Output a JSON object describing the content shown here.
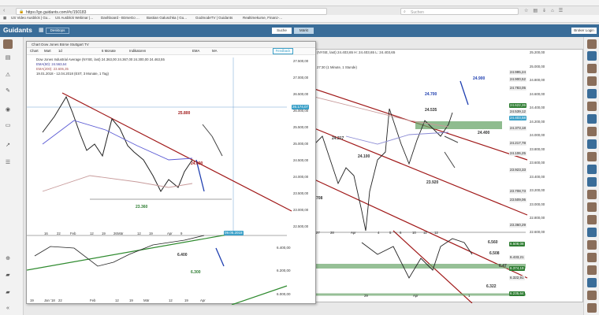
{
  "browser": {
    "url": "https://go.guidants.com/#c/150183",
    "search_placeholder": "Suchen"
  },
  "bookmarks": [
    "US Video Ausblick | Gu...",
    "US Ausblick Webinar |...",
    "Dashboard - BörseGo ...",
    "Bastian Galuschka | Gu...",
    "GodmodeTV | Guidants",
    "Realtimekurse, Finanz-..."
  ],
  "app": {
    "logo": "Guidants",
    "desktop": "Desktops",
    "search_btn": "Suche",
    "markt_btn": "Märkt",
    "broker_btn": "Broker Login",
    "colors": {
      "appbar": "#3a6d99",
      "accent": "#3aa0c8"
    }
  },
  "left_chart": {
    "title": "Chart Dow Jones Börse Stuttgart TV",
    "toolbar": [
      "Chart",
      "Mart",
      "1d",
      "6 Monate",
      "Indikatoren",
      "EMA",
      "MA",
      "Feedback"
    ],
    "legend": [
      "Dow Jones Industrial Average (NYSE, last)  24.363,00  24.367,00  24.300,00  24.463,55",
      "EMA(50): 24.563,64",
      "EMA(200): 23.606,35",
      "19.01.2018 - 12.04.2018 (EST, 3 Monate, 1 Tag)"
    ],
    "price_labels": [
      "27.500,00",
      "27.000,00",
      "26.500,00",
      "26.000,00",
      "25.500,00",
      "25.000,00",
      "24.500,00",
      "24.000,00",
      "23.500,00",
      "23.000,00",
      "22.500,00"
    ],
    "hl": "26.174,07",
    "date_tag": "09.05.2018",
    "annotations": {
      "a": "25.800",
      "b": "24.600",
      "c": "23.360"
    },
    "lower": {
      "labels": [
        "6.400,00",
        "6.200,00",
        "6.000,00"
      ],
      "a": "6.400",
      "b": "6.300"
    },
    "x_labels": [
      "16",
      "22",
      "Feb",
      "12",
      "19",
      "26",
      "Mär",
      "12",
      "19",
      "Apr",
      "9"
    ],
    "x_labels_lower": [
      "19",
      "Jan '18",
      "22",
      "Feb",
      "12",
      "19",
      "Mär",
      "12",
      "19",
      "Apr"
    ]
  },
  "right_chart": {
    "legend": [
      "(NYSE, last)  24.403,65  H: 24.403,65  L: 24.403,65",
      "27:30  (1 Minute, 1 Stunde)"
    ],
    "price_labels": [
      "25.200,00",
      "25.000,00",
      "24.800,00",
      "24.600,00",
      "24.400,00",
      "24.200,00",
      "24.000,00",
      "23.800,00",
      "23.600,00",
      "23.400,00",
      "23.200,00",
      "23.000,00",
      "22.800,00",
      "22.600,00"
    ],
    "tags": [
      "24.995,24",
      "24.900,52",
      "24.783,05",
      "24.622,26",
      "24.539,12",
      "24.403,58",
      "24.373,18",
      "24.217,78",
      "24.106,25",
      "23.923,33",
      "23.708,73",
      "23.509,06",
      "23.360,29"
    ],
    "annotations": {
      "a": "24.900",
      "b": "24.700",
      "c": "24.535",
      "d": "24.400",
      "e": "24.217",
      "f": "24.100",
      "g": "23.920",
      "h": "708"
    },
    "x_labels": [
      "27",
      "28",
      "Apr",
      "4",
      "5",
      "6",
      "10",
      "11",
      "12"
    ],
    "lower": {
      "tags": [
        "6.508,08",
        "6.433,21",
        "6.374,19",
        "6.322,91",
        "6.235,64"
      ],
      "a": "6.560",
      "b": "6.508",
      "c": "6.322",
      "d": "6.47"
    },
    "x_labels_lower": [
      "29",
      "Apr",
      "1"
    ]
  }
}
